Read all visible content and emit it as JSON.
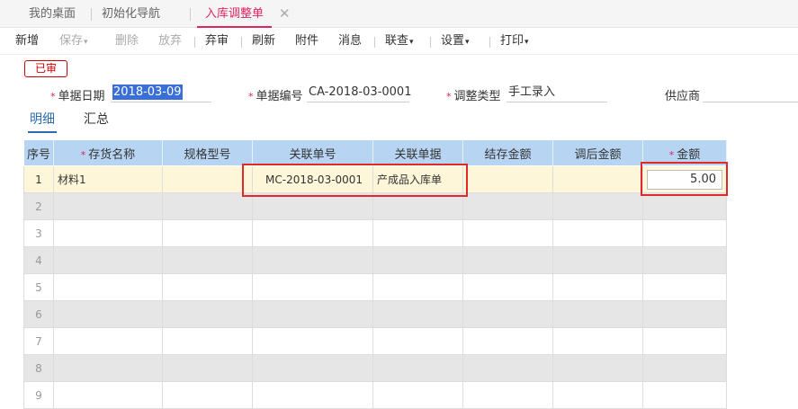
{
  "tabs": {
    "home": "我的桌面",
    "nav": "初始化导航",
    "active": "入库调整单",
    "close": "✕"
  },
  "toolbar": {
    "new": "新增",
    "save": "保存",
    "delete": "删除",
    "discard": "放弃",
    "unaudit": "弃审",
    "refresh": "刷新",
    "attach": "附件",
    "message": "消息",
    "link": "联查",
    "settings": "设置",
    "print": "打印",
    "caret": "▾"
  },
  "status_stamp": "已审",
  "header_fields": {
    "required_mark": "*",
    "date_label": "单据日期",
    "date_value": "2018-03-09",
    "number_label": "单据编号",
    "number_value": "CA-2018-03-0001",
    "type_label": "调整类型",
    "type_value": "手工录入",
    "supplier_label": "供应商",
    "supplier_value": ""
  },
  "subtabs": {
    "detail": "明细",
    "summary": "汇总"
  },
  "table": {
    "columns": {
      "seq": "序号",
      "inventory": "存货名称",
      "spec": "规格型号",
      "ref_no": "关联单号",
      "ref_doc": "关联单据",
      "stock_amount": "结存金额",
      "adjusted_amount": "调后金额",
      "amount": "金额"
    },
    "rows": [
      {
        "seq": "1",
        "inventory": "材料1",
        "spec": "",
        "ref_no": "MC-2018-03-0001",
        "ref_doc": "产成品入库单",
        "stock_amount": "",
        "adjusted_amount": "",
        "amount": "5.00"
      },
      {
        "seq": "2"
      },
      {
        "seq": "3"
      },
      {
        "seq": "4"
      },
      {
        "seq": "5"
      },
      {
        "seq": "6"
      },
      {
        "seq": "7"
      },
      {
        "seq": "8"
      },
      {
        "seq": "9"
      }
    ]
  }
}
